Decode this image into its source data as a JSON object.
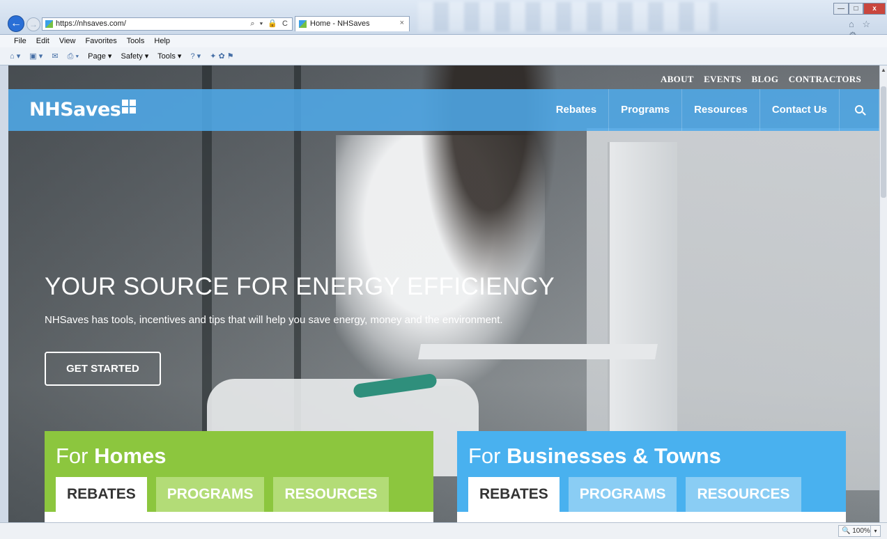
{
  "browser": {
    "url": "https://nhsaves.com/",
    "tab_title": "Home - NHSaves",
    "tab_close": "×",
    "back_glyph": "←",
    "forward_glyph": "→",
    "address_icons": "⌕ ▾ 🔒 C",
    "window_min": "—",
    "window_max": "□",
    "window_close": "x",
    "right_icons": "⌂ ☆ ⚙",
    "menu": [
      "File",
      "Edit",
      "View",
      "Favorites",
      "Tools",
      "Help"
    ],
    "command_bar": [
      "Page ▾",
      "Safety ▾",
      "Tools ▾"
    ],
    "zoom": "100%",
    "zoom_dropdown": "▾"
  },
  "site": {
    "top_links": [
      "ABOUT",
      "EVENTS",
      "BLOG",
      "CONTRACTORS"
    ],
    "logo": "NHSaves",
    "nav": [
      "Rebates",
      "Programs",
      "Resources",
      "Contact Us"
    ],
    "search_icon": "search-icon"
  },
  "hero": {
    "heading": "YOUR SOURCE FOR ENERGY EFFICIENCY",
    "subheading": "NHSaves has tools, incentives and tips that will help you save energy, money and the environment.",
    "cta": "GET STARTED"
  },
  "cards": {
    "homes": {
      "prefix": "For",
      "title": "Homes",
      "tabs": [
        "REBATES",
        "PROGRAMS",
        "RESOURCES"
      ],
      "active_tab": "REBATES",
      "color": "#8cc63e"
    },
    "business": {
      "prefix": "For",
      "title": "Businesses & Towns",
      "tabs": [
        "REBATES",
        "PROGRAMS",
        "RESOURCES"
      ],
      "active_tab": "REBATES",
      "color": "#49b1ef"
    }
  },
  "colors": {
    "nav_blue": "#4ea8e8",
    "homes_green": "#8cc63e",
    "business_blue": "#49b1ef"
  }
}
